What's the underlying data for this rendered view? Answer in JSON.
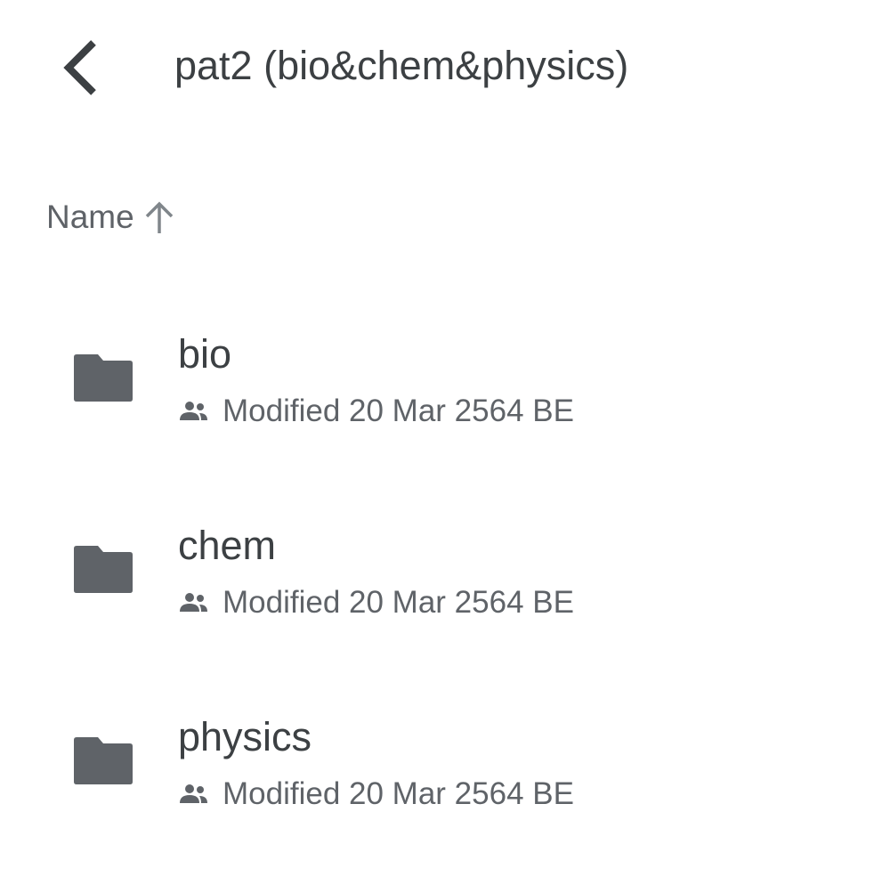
{
  "header": {
    "back_icon": "chevron-left-icon",
    "title": "pat2 (bio&chem&physics)"
  },
  "sort": {
    "label": "Name",
    "direction_icon": "arrow-up-icon"
  },
  "colors": {
    "text_primary": "#3c4043",
    "text_secondary": "#5f6368",
    "folder": "#5f6368",
    "sort_arrow": "#80868b"
  },
  "files": [
    {
      "name": "bio",
      "type_icon": "folder-icon",
      "shared_icon": "people-icon",
      "modified": "Modified 20 Mar 2564 BE"
    },
    {
      "name": "chem",
      "type_icon": "folder-icon",
      "shared_icon": "people-icon",
      "modified": "Modified 20 Mar 2564 BE"
    },
    {
      "name": "physics",
      "type_icon": "folder-icon",
      "shared_icon": "people-icon",
      "modified": "Modified 20 Mar 2564 BE"
    }
  ]
}
